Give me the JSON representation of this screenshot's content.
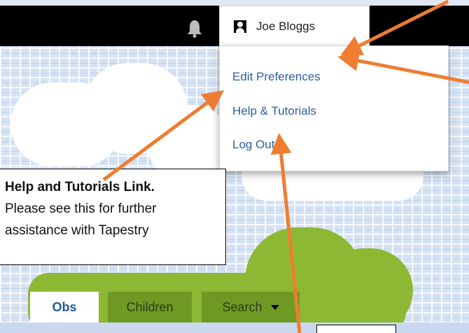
{
  "header": {
    "user_name": "Joe Bloggs"
  },
  "user_menu": {
    "items": [
      {
        "label": "Edit Preferences"
      },
      {
        "label": "Help & Tutorials"
      },
      {
        "label": "Log Out"
      }
    ]
  },
  "tabs": [
    {
      "label": "Obs",
      "active": true
    },
    {
      "label": "Children",
      "active": false
    },
    {
      "label": "Search",
      "active": false
    }
  ],
  "callout": {
    "title": "Help and Tutorials Link.",
    "line1": "Please see this for further",
    "line2": "assistance with Tapestry"
  },
  "colors": {
    "arrow": "#ee7d31",
    "link": "#2d5f9e",
    "tab_green": "#6e9a24",
    "bush_green": "#8db833"
  },
  "icons": [
    "bell-icon",
    "avatar-icon",
    "caret-down-icon"
  ]
}
